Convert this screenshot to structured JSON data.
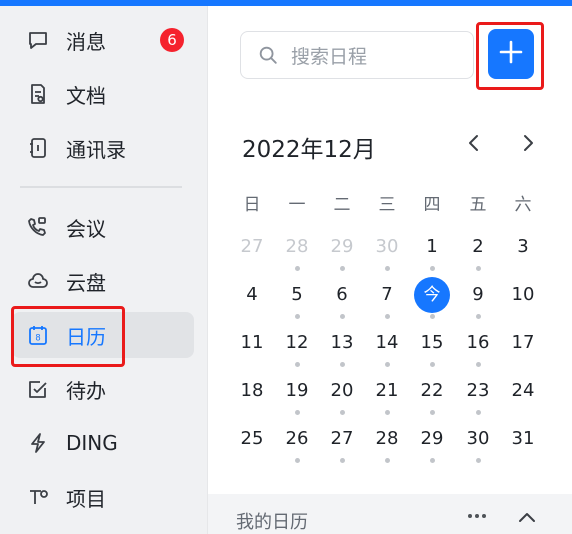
{
  "sidebar": {
    "items": [
      {
        "label": "消息",
        "icon": "chat-bubble-icon",
        "badge": "6"
      },
      {
        "label": "文档",
        "icon": "document-icon"
      },
      {
        "label": "通讯录",
        "icon": "contacts-book-icon"
      },
      {
        "label": "会议",
        "icon": "video-call-icon"
      },
      {
        "label": "云盘",
        "icon": "cloud-icon"
      },
      {
        "label": "日历",
        "icon": "calendar-icon",
        "icon_text": "8",
        "active": true
      },
      {
        "label": "待办",
        "icon": "checkbox-icon"
      },
      {
        "label": "DING",
        "icon": "lightning-icon"
      },
      {
        "label": "项目",
        "icon": "project-icon"
      }
    ]
  },
  "search": {
    "placeholder": "搜索日程"
  },
  "calendar": {
    "title": "2022年12月",
    "weekdays": [
      "日",
      "一",
      "二",
      "三",
      "四",
      "五",
      "六"
    ],
    "weeks": [
      [
        {
          "d": "27",
          "other": true
        },
        {
          "d": "28",
          "other": true
        },
        {
          "d": "29",
          "other": true
        },
        {
          "d": "30",
          "other": true
        },
        {
          "d": "1"
        },
        {
          "d": "2"
        },
        {
          "d": "3"
        }
      ],
      [
        {
          "d": "4"
        },
        {
          "d": "5"
        },
        {
          "d": "6"
        },
        {
          "d": "7"
        },
        {
          "d": "今",
          "today": true
        },
        {
          "d": "9"
        },
        {
          "d": "10"
        }
      ],
      [
        {
          "d": "11"
        },
        {
          "d": "12"
        },
        {
          "d": "13"
        },
        {
          "d": "14"
        },
        {
          "d": "15"
        },
        {
          "d": "16"
        },
        {
          "d": "17"
        }
      ],
      [
        {
          "d": "18"
        },
        {
          "d": "19"
        },
        {
          "d": "20"
        },
        {
          "d": "21"
        },
        {
          "d": "22"
        },
        {
          "d": "23"
        },
        {
          "d": "24"
        }
      ],
      [
        {
          "d": "25"
        },
        {
          "d": "26"
        },
        {
          "d": "27"
        },
        {
          "d": "28"
        },
        {
          "d": "29"
        },
        {
          "d": "30"
        },
        {
          "d": "31"
        }
      ]
    ],
    "dots": [
      [
        false,
        true,
        true,
        true,
        true,
        true,
        false
      ],
      [
        false,
        true,
        true,
        true,
        true,
        true,
        false
      ],
      [
        false,
        true,
        true,
        true,
        true,
        true,
        false
      ],
      [
        false,
        true,
        true,
        true,
        true,
        true,
        false
      ],
      [
        false,
        true,
        true,
        true,
        true,
        true,
        false
      ]
    ]
  },
  "footer": {
    "label": "我的日历"
  },
  "colors": {
    "accent": "#1677ff",
    "badge": "#f5222d",
    "highlight_box": "#ea1a1a"
  }
}
